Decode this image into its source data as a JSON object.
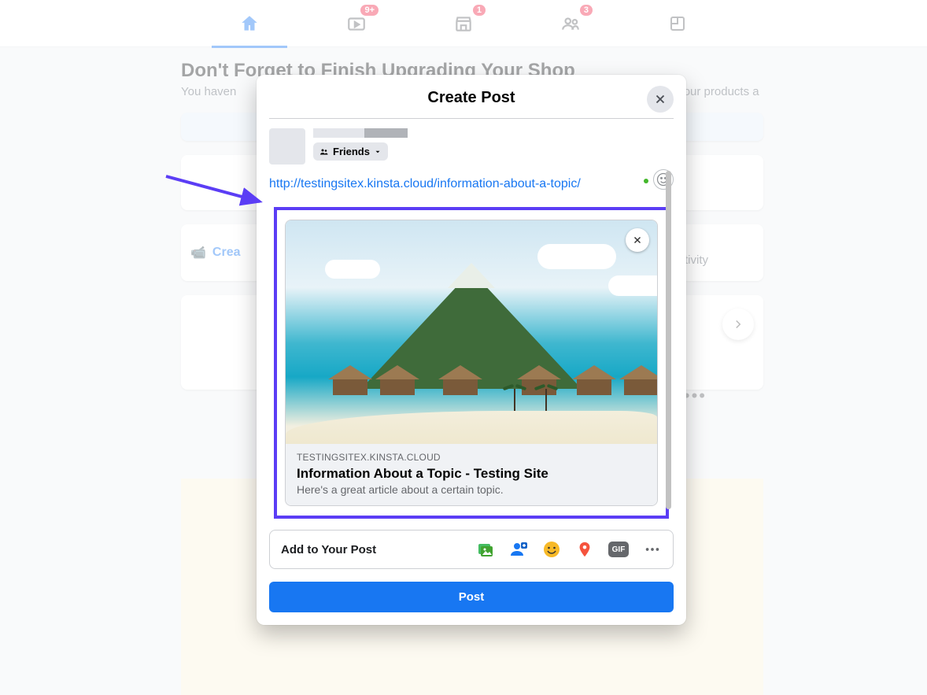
{
  "nav": {
    "badges": {
      "watch": "9+",
      "market": "1",
      "groups": "3"
    }
  },
  "feed": {
    "shop_title": "Don't Forget to Finish Upgrading Your Shop",
    "shop_sub_left": "You haven",
    "shop_sub_right": "e your products a",
    "activity_fragment": "tivity",
    "create_fragment": "Crea"
  },
  "modal": {
    "title": "Create Post",
    "audience_label": "Friends",
    "url": "http://testingsitex.kinsta.cloud/information-about-a-topic/",
    "link_preview": {
      "domain": "TESTINGSITEX.KINSTA.CLOUD",
      "title": "Information About a Topic - Testing Site",
      "description": "Here's a great article about a certain topic."
    },
    "add_label": "Add to Your Post",
    "add_icons": {
      "photo": "photo-video-icon",
      "tag": "tag-people-icon",
      "emoji": "feeling-icon",
      "location": "location-icon",
      "gif": "GIF",
      "more": "more-icon"
    },
    "post_label": "Post"
  }
}
